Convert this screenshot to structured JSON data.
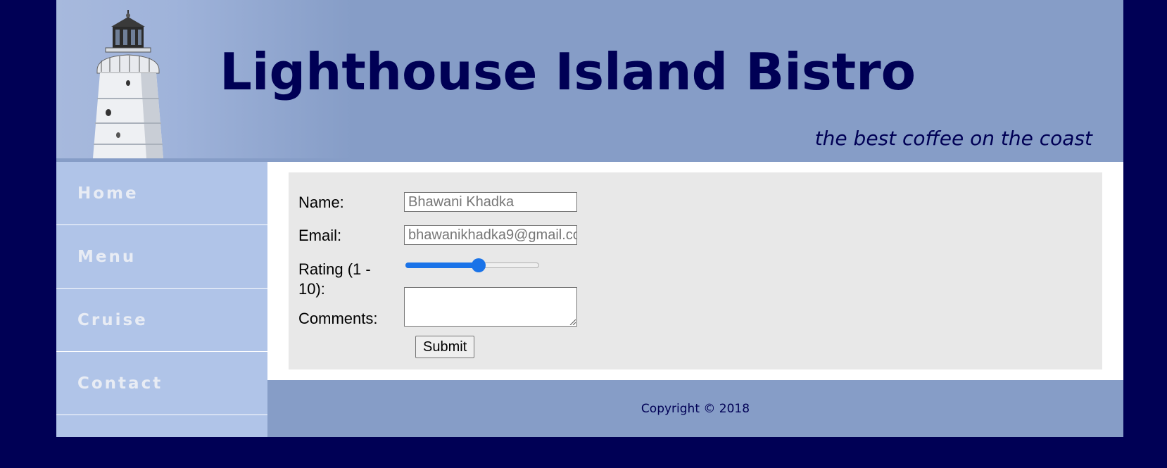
{
  "header": {
    "title": "Lighthouse Island Bistro",
    "tagline": "the best coffee on the coast",
    "image": "lighthouse-image"
  },
  "nav": {
    "items": [
      {
        "label": "Home"
      },
      {
        "label": "Menu"
      },
      {
        "label": "Cruise"
      },
      {
        "label": "Contact"
      }
    ]
  },
  "form": {
    "name_label": "Name:",
    "name_value": "Bhawani Khadka",
    "email_label": "Email:",
    "email_value": "bhawanikhadka9@gmail.co",
    "rating_label": "Rating (1 - 10):",
    "rating": {
      "min": 1,
      "max": 10,
      "value": 6
    },
    "comments_label": "Comments:",
    "comments_value": "",
    "submit_label": "Submit"
  },
  "footer": {
    "copyright": "Copyright © 2018"
  },
  "colors": {
    "page_background": "#000055",
    "header_background": "#869dc7",
    "nav_background": "#b0c4e8",
    "form_background": "#e8e8e8",
    "slider_accent": "#1a73e8",
    "text_dark": "#000055"
  }
}
